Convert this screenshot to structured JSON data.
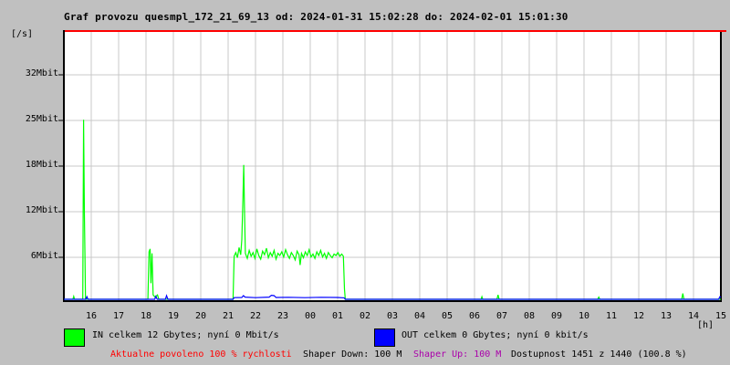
{
  "window": {
    "title": "Graf provozu quesmpl_172_21_69_13 od: 2024-01-31 15:02:28 do: 2024-02-01 15:01:30"
  },
  "axes": {
    "y_unit": "[/s]",
    "x_unit": "[h]"
  },
  "chart_data": {
    "type": "line",
    "title": "Graf provozu quesmpl_172_21_69_13 od: 2024-01-31 15:02:28 do: 2024-02-01 15:01:30",
    "xlabel": "[h]",
    "ylabel": "[/s]",
    "x_hours_range": [
      0,
      24
    ],
    "x_ticks": [
      "16",
      "17",
      "18",
      "19",
      "20",
      "21",
      "22",
      "23",
      "00",
      "01",
      "02",
      "03",
      "04",
      "05",
      "06",
      "07",
      "08",
      "09",
      "10",
      "11",
      "12",
      "13",
      "14",
      "15"
    ],
    "y_ticks": [
      {
        "value": 32,
        "label": "32Mbit"
      },
      {
        "value": 25,
        "label": "25Mbit"
      },
      {
        "value": 18,
        "label": "18Mbit"
      },
      {
        "value": 12,
        "label": "12Mbit"
      },
      {
        "value": 6,
        "label": "6Mbit"
      }
    ],
    "grid": true,
    "legend_position": "bottom",
    "series": [
      {
        "name": "IN",
        "unit": "Mbit/s",
        "color": "#00ff00",
        "points": [
          [
            0,
            0
          ],
          [
            0.33,
            0
          ],
          [
            0.36,
            0.4
          ],
          [
            0.39,
            0
          ],
          [
            0.69,
            0
          ],
          [
            0.72,
            24.6
          ],
          [
            0.75,
            11.5
          ],
          [
            0.77,
            6
          ],
          [
            0.79,
            0
          ],
          [
            3.07,
            0
          ],
          [
            3.11,
            6.5
          ],
          [
            3.15,
            6.9
          ],
          [
            3.18,
            2.2
          ],
          [
            3.22,
            6.3
          ],
          [
            3.26,
            0.6
          ],
          [
            3.33,
            0.3
          ],
          [
            3.42,
            0.6
          ],
          [
            3.47,
            0
          ],
          [
            6.18,
            0
          ],
          [
            6.22,
            5.9
          ],
          [
            6.28,
            6.4
          ],
          [
            6.34,
            5.7
          ],
          [
            6.4,
            7.1
          ],
          [
            6.46,
            6.1
          ],
          [
            6.5,
            8.2
          ],
          [
            6.54,
            13.6
          ],
          [
            6.57,
            18.4
          ],
          [
            6.6,
            11.8
          ],
          [
            6.63,
            6.3
          ],
          [
            6.7,
            5.6
          ],
          [
            6.77,
            6.7
          ],
          [
            6.84,
            5.9
          ],
          [
            6.91,
            6.4
          ],
          [
            6.98,
            5.6
          ],
          [
            7.05,
            6.9
          ],
          [
            7.12,
            6
          ],
          [
            7.19,
            5.5
          ],
          [
            7.26,
            6.6
          ],
          [
            7.33,
            6.1
          ],
          [
            7.4,
            7
          ],
          [
            7.47,
            5.7
          ],
          [
            7.54,
            6.4
          ],
          [
            7.61,
            5.9
          ],
          [
            7.68,
            6.7
          ],
          [
            7.75,
            5.5
          ],
          [
            7.82,
            6.3
          ],
          [
            7.89,
            6
          ],
          [
            7.96,
            6.5
          ],
          [
            8.03,
            5.8
          ],
          [
            8.1,
            6.8
          ],
          [
            8.17,
            6.1
          ],
          [
            8.24,
            5.6
          ],
          [
            8.31,
            6.4
          ],
          [
            8.38,
            6
          ],
          [
            8.45,
            5.4
          ],
          [
            8.52,
            6.6
          ],
          [
            8.59,
            6.1
          ],
          [
            8.63,
            4.7
          ],
          [
            8.68,
            6.3
          ],
          [
            8.75,
            5.7
          ],
          [
            8.82,
            6.5
          ],
          [
            8.89,
            6
          ],
          [
            8.96,
            6.8
          ],
          [
            9.03,
            5.8
          ],
          [
            9.1,
            6.2
          ],
          [
            9.17,
            5.6
          ],
          [
            9.24,
            6.5
          ],
          [
            9.31,
            6
          ],
          [
            9.38,
            6.7
          ],
          [
            9.45,
            5.8
          ],
          [
            9.52,
            6.3
          ],
          [
            9.59,
            5.6
          ],
          [
            9.66,
            6.4
          ],
          [
            9.73,
            6
          ],
          [
            9.8,
            5.7
          ],
          [
            9.87,
            6.2
          ],
          [
            9.94,
            6
          ],
          [
            10.01,
            6.4
          ],
          [
            10.08,
            5.9
          ],
          [
            10.15,
            6.2
          ],
          [
            10.21,
            5.9
          ],
          [
            10.25,
            1.4
          ],
          [
            10.28,
            0
          ],
          [
            15.24,
            0
          ],
          [
            15.27,
            0.35
          ],
          [
            15.3,
            0
          ],
          [
            15.82,
            0
          ],
          [
            15.86,
            0.6
          ],
          [
            15.9,
            0
          ],
          [
            19.5,
            0
          ],
          [
            19.54,
            0.3
          ],
          [
            19.58,
            0
          ],
          [
            22.57,
            0
          ],
          [
            22.61,
            0.8
          ],
          [
            22.65,
            0
          ],
          [
            24,
            0
          ]
        ]
      },
      {
        "name": "OUT",
        "unit": "kbit/s",
        "color": "#0000ff",
        "points": [
          [
            0,
            0
          ],
          [
            0.8,
            0
          ],
          [
            0.84,
            0.35
          ],
          [
            0.88,
            0
          ],
          [
            3.32,
            0
          ],
          [
            3.36,
            0.4
          ],
          [
            3.41,
            0
          ],
          [
            3.71,
            0
          ],
          [
            3.75,
            0.5
          ],
          [
            3.8,
            0
          ],
          [
            6.18,
            0
          ],
          [
            6.22,
            0.22
          ],
          [
            6.5,
            0.25
          ],
          [
            6.56,
            0.5
          ],
          [
            6.62,
            0.3
          ],
          [
            7,
            0.22
          ],
          [
            7.5,
            0.3
          ],
          [
            7.58,
            0.55
          ],
          [
            7.68,
            0.5
          ],
          [
            7.75,
            0.25
          ],
          [
            8.2,
            0.28
          ],
          [
            8.8,
            0.22
          ],
          [
            9.4,
            0.28
          ],
          [
            10,
            0.25
          ],
          [
            10.24,
            0.2
          ],
          [
            10.28,
            0
          ],
          [
            23.92,
            0
          ],
          [
            23.96,
            0.35
          ],
          [
            24,
            0.3
          ]
        ]
      }
    ]
  },
  "legend": [
    {
      "name": "IN",
      "color": "#00ff00",
      "label": "IN celkem 12 Gbytes; nyní 0 Mbit/s"
    },
    {
      "name": "OUT",
      "color": "#0000ff",
      "label": "OUT celkem 0 Gbytes; nyní 0 kbit/s"
    }
  ],
  "status_bar": {
    "allowed_text": "Aktualne povoleno 100 % rychlosti",
    "shaper_down_text": "Shaper Down: 100 M",
    "shaper_up_text": "Shaper Up: 100 M",
    "availability_text": "Dostupnost 1451 z 1440 (100.8 %)"
  },
  "colors": {
    "background": "#c0c0c0",
    "plot_background": "#ffffff",
    "grid": "#c9c9c9",
    "border": "#000000",
    "top_border": "#ff0000",
    "in_series": "#00ff00",
    "out_series": "#0000ff",
    "allowed_text": "#ff0000",
    "shaper_up_text": "#aa00aa",
    "text": "#000000"
  }
}
